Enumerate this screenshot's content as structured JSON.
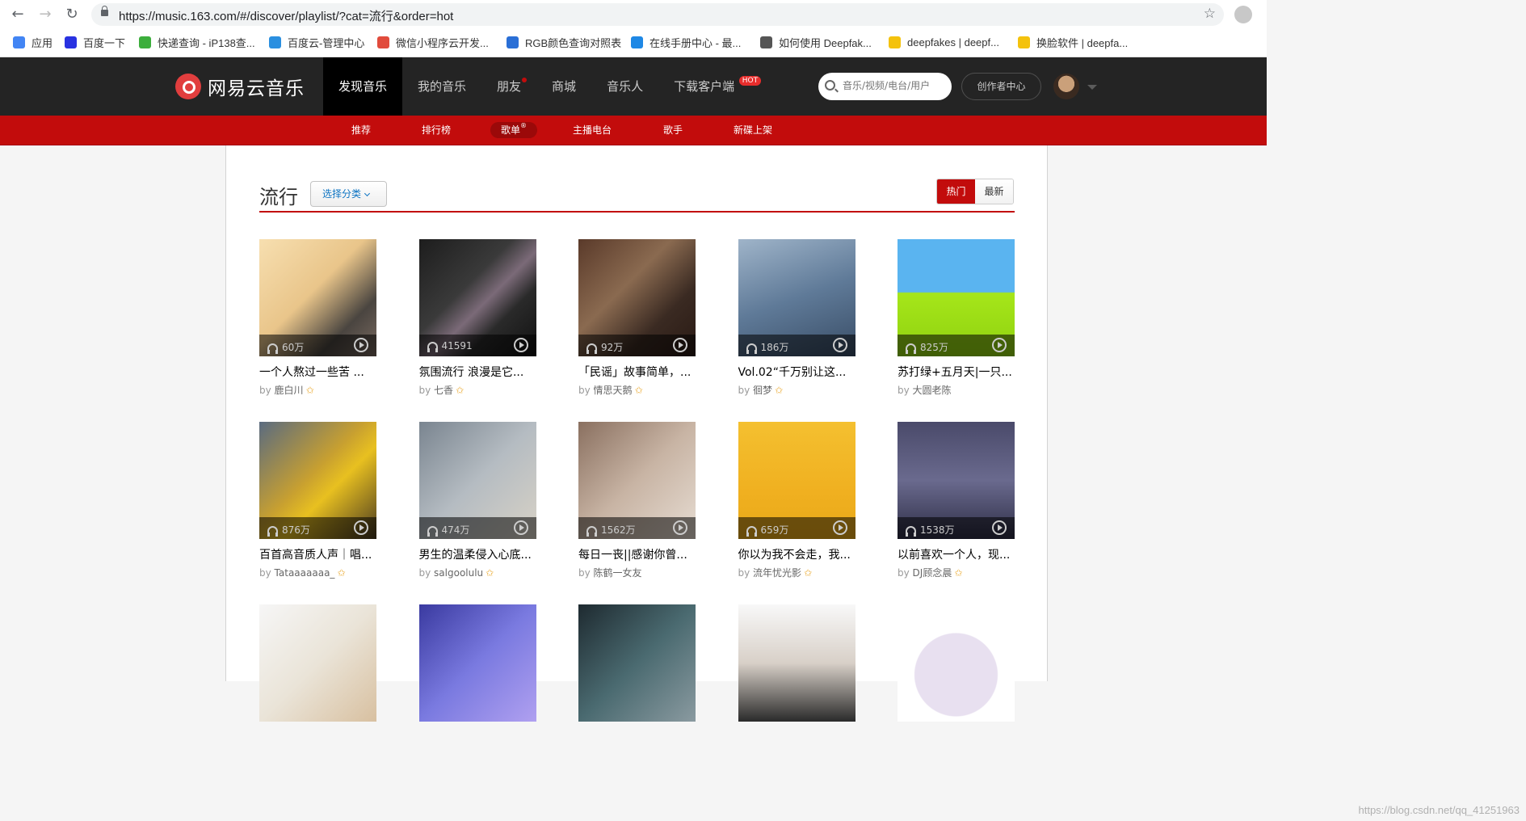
{
  "browser": {
    "url": "https://music.163.com/#/discover/playlist/?cat=流行&order=hot",
    "bookmarks": [
      {
        "label": "应用",
        "color": "#4285f4"
      },
      {
        "label": "百度一下",
        "color": "#2932e1"
      },
      {
        "label": "快递查询 - iP138查...",
        "color": "#3cae3c"
      },
      {
        "label": "百度云-管理中心",
        "color": "#2a8fe0"
      },
      {
        "label": "微信小程序云开发...",
        "color": "#e14b3c"
      },
      {
        "label": "RGB颜色查询对照表",
        "color": "#2a6fd6"
      },
      {
        "label": "在线手册中心 - 最...",
        "color": "#1e88e5"
      },
      {
        "label": "如何使用 Deepfak...",
        "color": "#555555"
      },
      {
        "label": "deepfakes | deepf...",
        "color": "#f4c20d"
      },
      {
        "label": "换脸软件 | deepfa...",
        "color": "#f4c20d"
      }
    ]
  },
  "site": {
    "logo": "网易云音乐",
    "nav": [
      {
        "label": "发现音乐",
        "active": true
      },
      {
        "label": "我的音乐"
      },
      {
        "label": "朋友",
        "dot": true
      },
      {
        "label": "商城"
      },
      {
        "label": "音乐人"
      },
      {
        "label": "下载客户端",
        "hot": "HOT"
      }
    ],
    "search_placeholder": "音乐/视频/电台/用户",
    "creator_label": "创作者中心",
    "subnav": [
      {
        "label": "推荐"
      },
      {
        "label": "排行榜"
      },
      {
        "label": "歌单",
        "active": true,
        "sup": "®"
      },
      {
        "label": "主播电台"
      },
      {
        "label": "歌手"
      },
      {
        "label": "新碟上架"
      }
    ]
  },
  "page": {
    "heading": "流行",
    "category_button": "选择分类",
    "order_hot": "热门",
    "order_new": "最新",
    "by_prefix": "by",
    "playlists": [
      {
        "count": "60万",
        "title": "一个人熬过一些苦 ...",
        "author": "鹿白川",
        "vip": true,
        "bg": "linear-gradient(135deg,#f7dfb0,#e9c58a 45%,#4a4540 75%,#7a6a60)"
      },
      {
        "count": "41591",
        "title": "氛围流行 浪漫是它...",
        "author": "七香",
        "vip": true,
        "bg": "linear-gradient(135deg,#1d1d1d,#3a3a3a 40%,#7b6a78 55%,#2a2a2a 70%,#111)"
      },
      {
        "count": "92万",
        "title": "「民谣」故事简单，...",
        "author": "情思天鹅",
        "vip": true,
        "bg": "linear-gradient(135deg,#5a3a2a,#8a6a50 40%,#3a2a22 70%,#2a1a14)"
      },
      {
        "count": "186万",
        "title": "Vol.02“千万别让这...",
        "author": "徊梦",
        "vip": true,
        "bg": "linear-gradient(160deg,#9fb4c9,#5f7a98 50%,#394d66)"
      },
      {
        "count": "825万",
        "title": "苏打绿+五月天|一只...",
        "author": "大圆老陈",
        "vip": false,
        "bg": "linear-gradient(180deg,#5ab4f0 0 45%,#a6e61a 46%,#8fd10f 100%)"
      },
      {
        "count": "876万",
        "title": "百首高音质人声｜唱...",
        "author": "Tataaaaaaa_",
        "vip": true,
        "bg": "linear-gradient(135deg,#5a6b80,#c8a030 45%,#e8c020 60%,#4a3a20)"
      },
      {
        "count": "474万",
        "title": "男生的温柔侵入心底...",
        "author": "salgoolulu",
        "vip": true,
        "bg": "linear-gradient(135deg,#7a8590,#b5bcc2 50%,#d8d2c6)"
      },
      {
        "count": "1562万",
        "title": "每日一丧||感谢你曾...",
        "author": "陈鹤一女友",
        "vip": false,
        "bg": "linear-gradient(135deg,#8a7060,#c8b4a4 50%,#e6dcd2)"
      },
      {
        "count": "659万",
        "title": "你以为我不会走，我...",
        "author": "流年忧光影",
        "vip": true,
        "bg": "linear-gradient(180deg,#f4c030,#f0b020 60%,#e8a818)"
      },
      {
        "count": "1538万",
        "title": "以前喜欢一个人，现...",
        "author": "DJ顾念晨",
        "vip": true,
        "bg": "linear-gradient(180deg,#4a4a6a,#6a6a8e 50%,#2e2e46)"
      },
      {
        "bg": "linear-gradient(135deg,#f6f6f6,#eae4d8 50%,#d8c0a0)"
      },
      {
        "bg": "linear-gradient(135deg,#3a3aa0,#7a7ae0 50%,#b0a0f0)"
      },
      {
        "bg": "linear-gradient(135deg,#1e2a30,#4a6a70 50%,#8a9aa0)"
      },
      {
        "bg": "linear-gradient(180deg,#f8f8f8,#d8d0c8 50%,#2a2a2a)"
      },
      {
        "bg": "radial-gradient(circle at 50% 60%,#e8e0f0 0 45%,#fff 46%)"
      }
    ]
  },
  "watermark": "https://blog.csdn.net/qq_41251963"
}
